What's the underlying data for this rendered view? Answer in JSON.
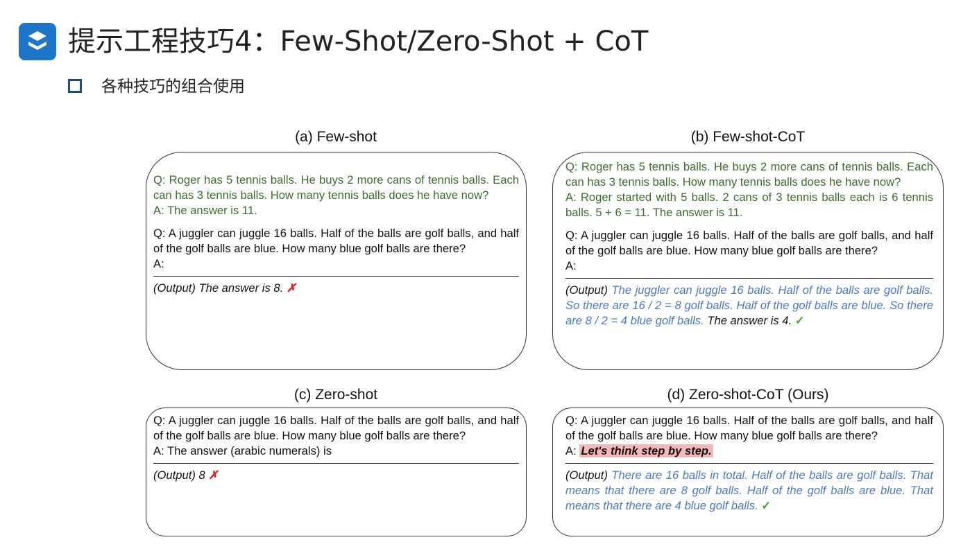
{
  "header": {
    "logo_icon": "s-logo-icon",
    "title": "提示工程技巧4：Few-Shot/Zero-Shot + CoT",
    "bullet": "各种技巧的组合使用"
  },
  "panels": {
    "a": {
      "title": "(a) Few-shot",
      "ex_q": "Q: Roger has 5 tennis balls. He buys 2 more cans of tennis balls. Each can has 3 tennis balls. How many tennis balls does he have now?",
      "ex_a": "A: The answer is 11.",
      "q": "Q: A juggler can juggle 16 balls. Half of the balls are golf balls, and half of the golf balls are blue. How many blue golf balls are there?",
      "a": "A:",
      "output": "(Output) The answer is 8.",
      "mark": "✗"
    },
    "b": {
      "title": "(b) Few-shot-CoT",
      "ex_q": "Q: Roger has 5 tennis balls. He buys 2 more cans of tennis balls. Each can has 3 tennis balls. How many tennis balls does he have now?",
      "ex_a": "A: Roger started with 5 balls. 2 cans of 3 tennis balls each is 6 tennis balls. 5 + 6 = 11. The answer is 11.",
      "q": "Q: A juggler can juggle 16 balls. Half of the balls are golf balls, and half of the golf balls are blue. How many blue golf balls are there?",
      "a": "A:",
      "output_label": "(Output)",
      "output_reasoning": "The juggler can juggle 16 balls. Half of the balls are golf balls. So there are 16 / 2 = 8 golf balls. Half of the golf balls are blue. So there are 8 / 2 = 4 blue golf balls.",
      "output_answer": "The answer is 4.",
      "mark": "✓"
    },
    "c": {
      "title": "(c) Zero-shot",
      "q": "Q: A juggler can juggle 16 balls. Half of the balls are golf balls, and half of the golf balls are blue. How many blue golf balls are there?",
      "a": "A: The answer (arabic numerals) is",
      "output": "(Output) 8",
      "mark": "✗"
    },
    "d": {
      "title": "(d) Zero-shot-CoT (Ours)",
      "q": "Q: A juggler can juggle 16 balls. Half of the balls are golf balls, and half of the golf balls are blue. How many blue golf balls are there?",
      "a_prefix": "A:",
      "a_prompt": "Let's think step by step.",
      "output_label": "(Output)",
      "output_reasoning": "There are 16 balls in total. Half of the balls are golf balls. That means that there are 8 golf balls. Half of the golf balls are blue. That means that there are 4 blue golf balls.",
      "mark": "✓"
    }
  }
}
